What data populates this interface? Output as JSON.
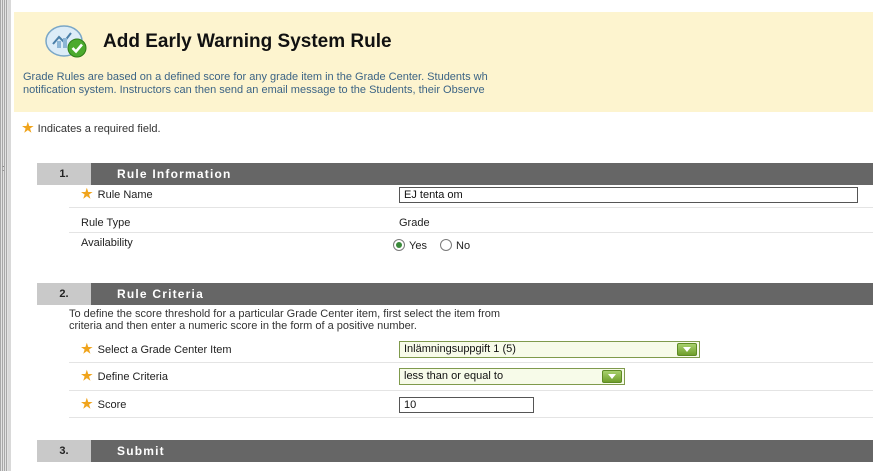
{
  "header": {
    "title": "Add Early Warning System Rule",
    "description_line1": "Grade Rules are based on a defined score for any grade item in the Grade Center. Students wh",
    "description_line2": "notification system. Instructors can then send an email message to the Students, their Observe"
  },
  "required_note": "Indicates a required field.",
  "sections": {
    "rule_information": {
      "number": "1.",
      "title": "Rule Information",
      "rule_name_label": "Rule Name",
      "rule_name_value": "EJ tenta om",
      "rule_type_label": "Rule Type",
      "rule_type_value": "Grade",
      "availability_label": "Availability",
      "availability_yes": "Yes",
      "availability_no": "No",
      "availability_selected": "Yes"
    },
    "rule_criteria": {
      "number": "2.",
      "title": "Rule Criteria",
      "description_line1": "To define the score threshold for a particular Grade Center item, first select the item from",
      "description_line2": "criteria and then enter a numeric score in the form of a positive number.",
      "grade_item_label": "Select a Grade Center Item",
      "grade_item_value": "Inlämningsuppgift 1 (5)",
      "criteria_label": "Define Criteria",
      "criteria_value": "less than or equal to",
      "score_label": "Score",
      "score_value": "10"
    },
    "submit": {
      "number": "3.",
      "title": "Submit"
    }
  },
  "colors": {
    "header_background": "#fdf4cf",
    "step_bar": "#666666",
    "step_number_bg": "#c9c9c9",
    "required_star": "#f0a41c",
    "description_text": "#3c6485",
    "select_background": "#f7fbe9",
    "select_arrow": "#6f9e2b"
  },
  "icons": {
    "title_icon": "early-warning-rule-icon",
    "required": "asterisk-star-icon",
    "select_arrow": "chevron-down-icon"
  }
}
